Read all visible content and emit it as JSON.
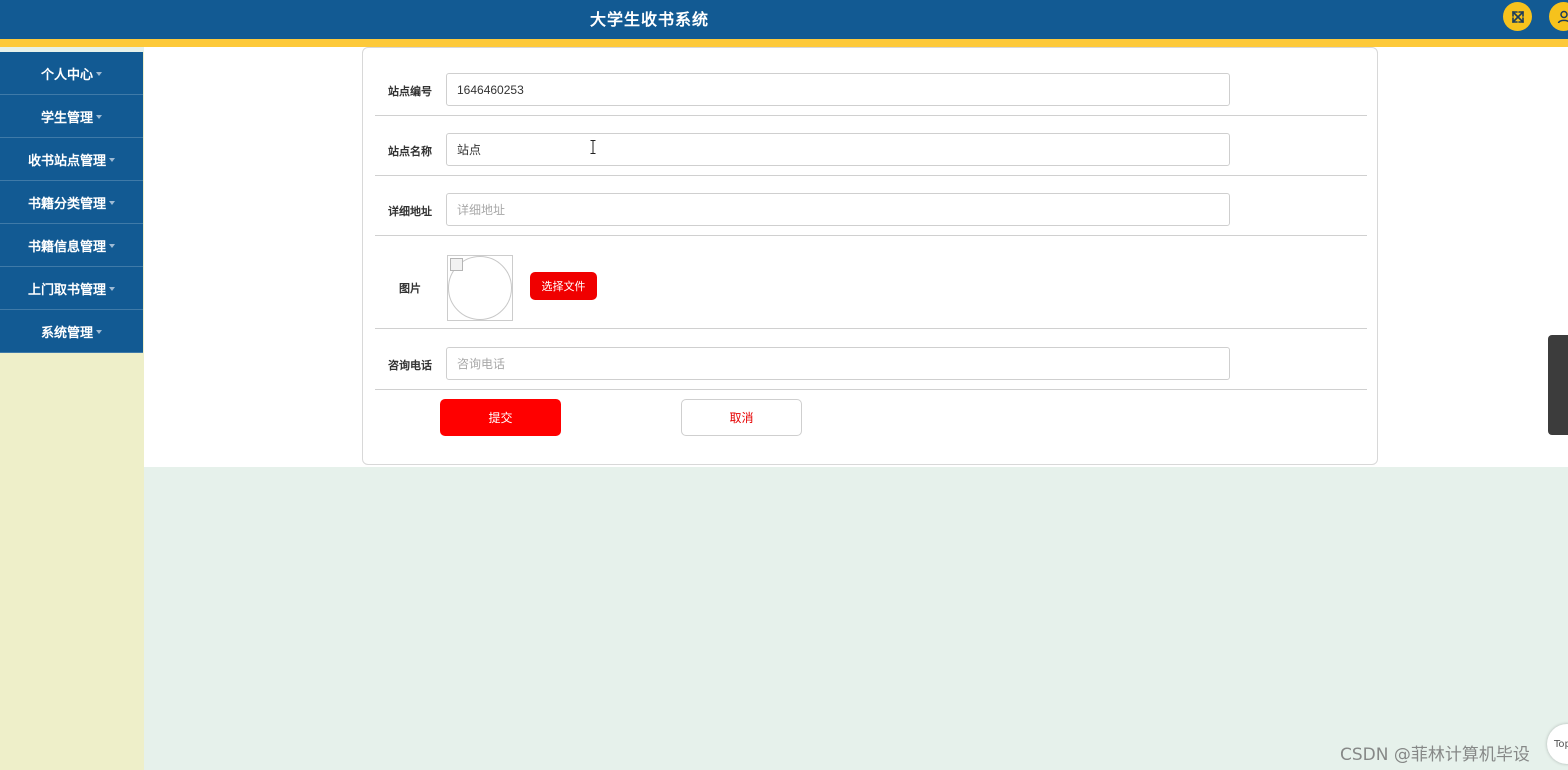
{
  "header": {
    "title": "大学生收书系统",
    "expand_icon": "expand-arrows-icon",
    "user_icon": "user-icon",
    "bg_color": "#125a93",
    "accent_color": "#fdc93a"
  },
  "sidebar": {
    "items": [
      {
        "label": "个人中心"
      },
      {
        "label": "学生管理"
      },
      {
        "label": "收书站点管理"
      },
      {
        "label": "书籍分类管理"
      },
      {
        "label": "书籍信息管理"
      },
      {
        "label": "上门取书管理"
      },
      {
        "label": "系统管理"
      }
    ]
  },
  "form": {
    "station_no": {
      "label": "站点编号",
      "value": "1646460253",
      "placeholder": ""
    },
    "station_name": {
      "label": "站点名称",
      "value": "站点",
      "placeholder": ""
    },
    "address": {
      "label": "详细地址",
      "value": "",
      "placeholder": "详细地址"
    },
    "image": {
      "label": "图片",
      "choose_label": "选择文件"
    },
    "phone": {
      "label": "咨询电话",
      "value": "",
      "placeholder": "咨询电话"
    },
    "submit_label": "提交",
    "cancel_label": "取消",
    "primary_color": "#ff0000"
  },
  "floating": {
    "top_label": "Top"
  },
  "watermark": "CSDN @菲林计算机毕设"
}
